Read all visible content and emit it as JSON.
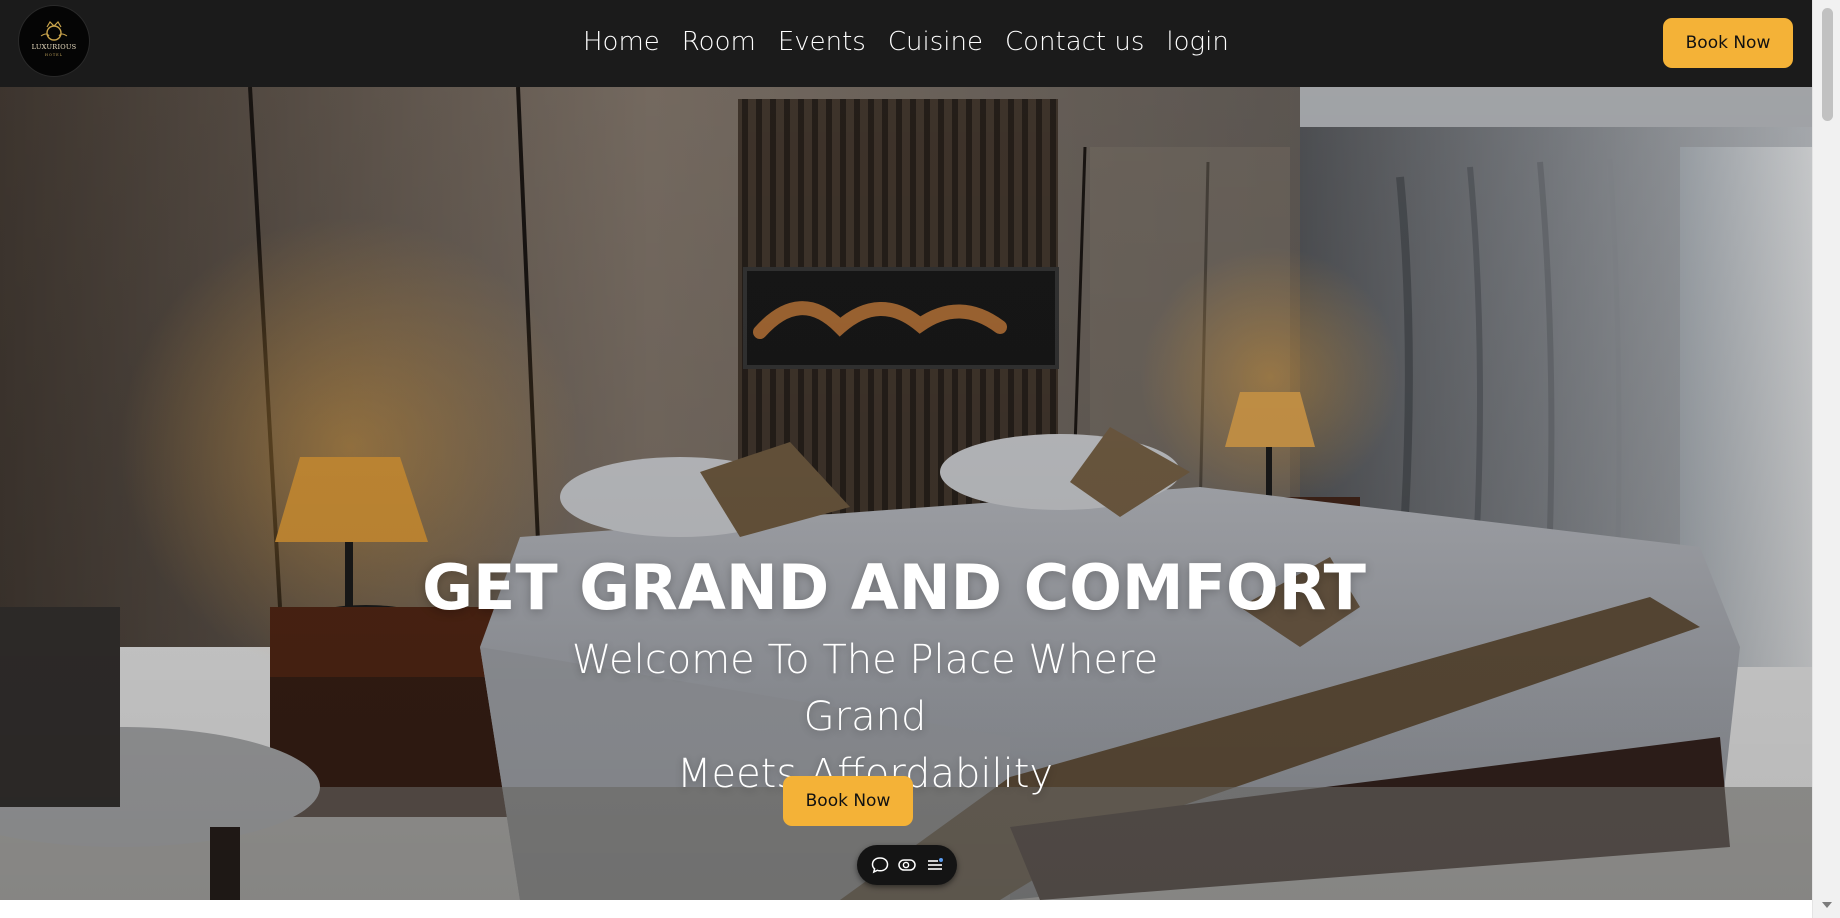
{
  "brand": {
    "logo_text": "LUXURIOUS",
    "logo_subtext": "HOTEL"
  },
  "nav": {
    "links": [
      "Home",
      "Room",
      "Events",
      "Cuisine",
      "Contact us",
      "login"
    ],
    "book_label": "Book Now"
  },
  "hero": {
    "title": "GET GRAND AND COMFORT",
    "subtitle_line1": "Welcome To The Place Where Grand",
    "subtitle_line2": "Meets Affordability",
    "book_label": "Book Now"
  },
  "toolbar": {
    "icons": [
      "chat-icon",
      "toggle-icon",
      "list-icon"
    ]
  },
  "colors": {
    "navbar_bg": "#1b1b1b",
    "accent": "#f4b237",
    "text_light": "#ffffff"
  }
}
